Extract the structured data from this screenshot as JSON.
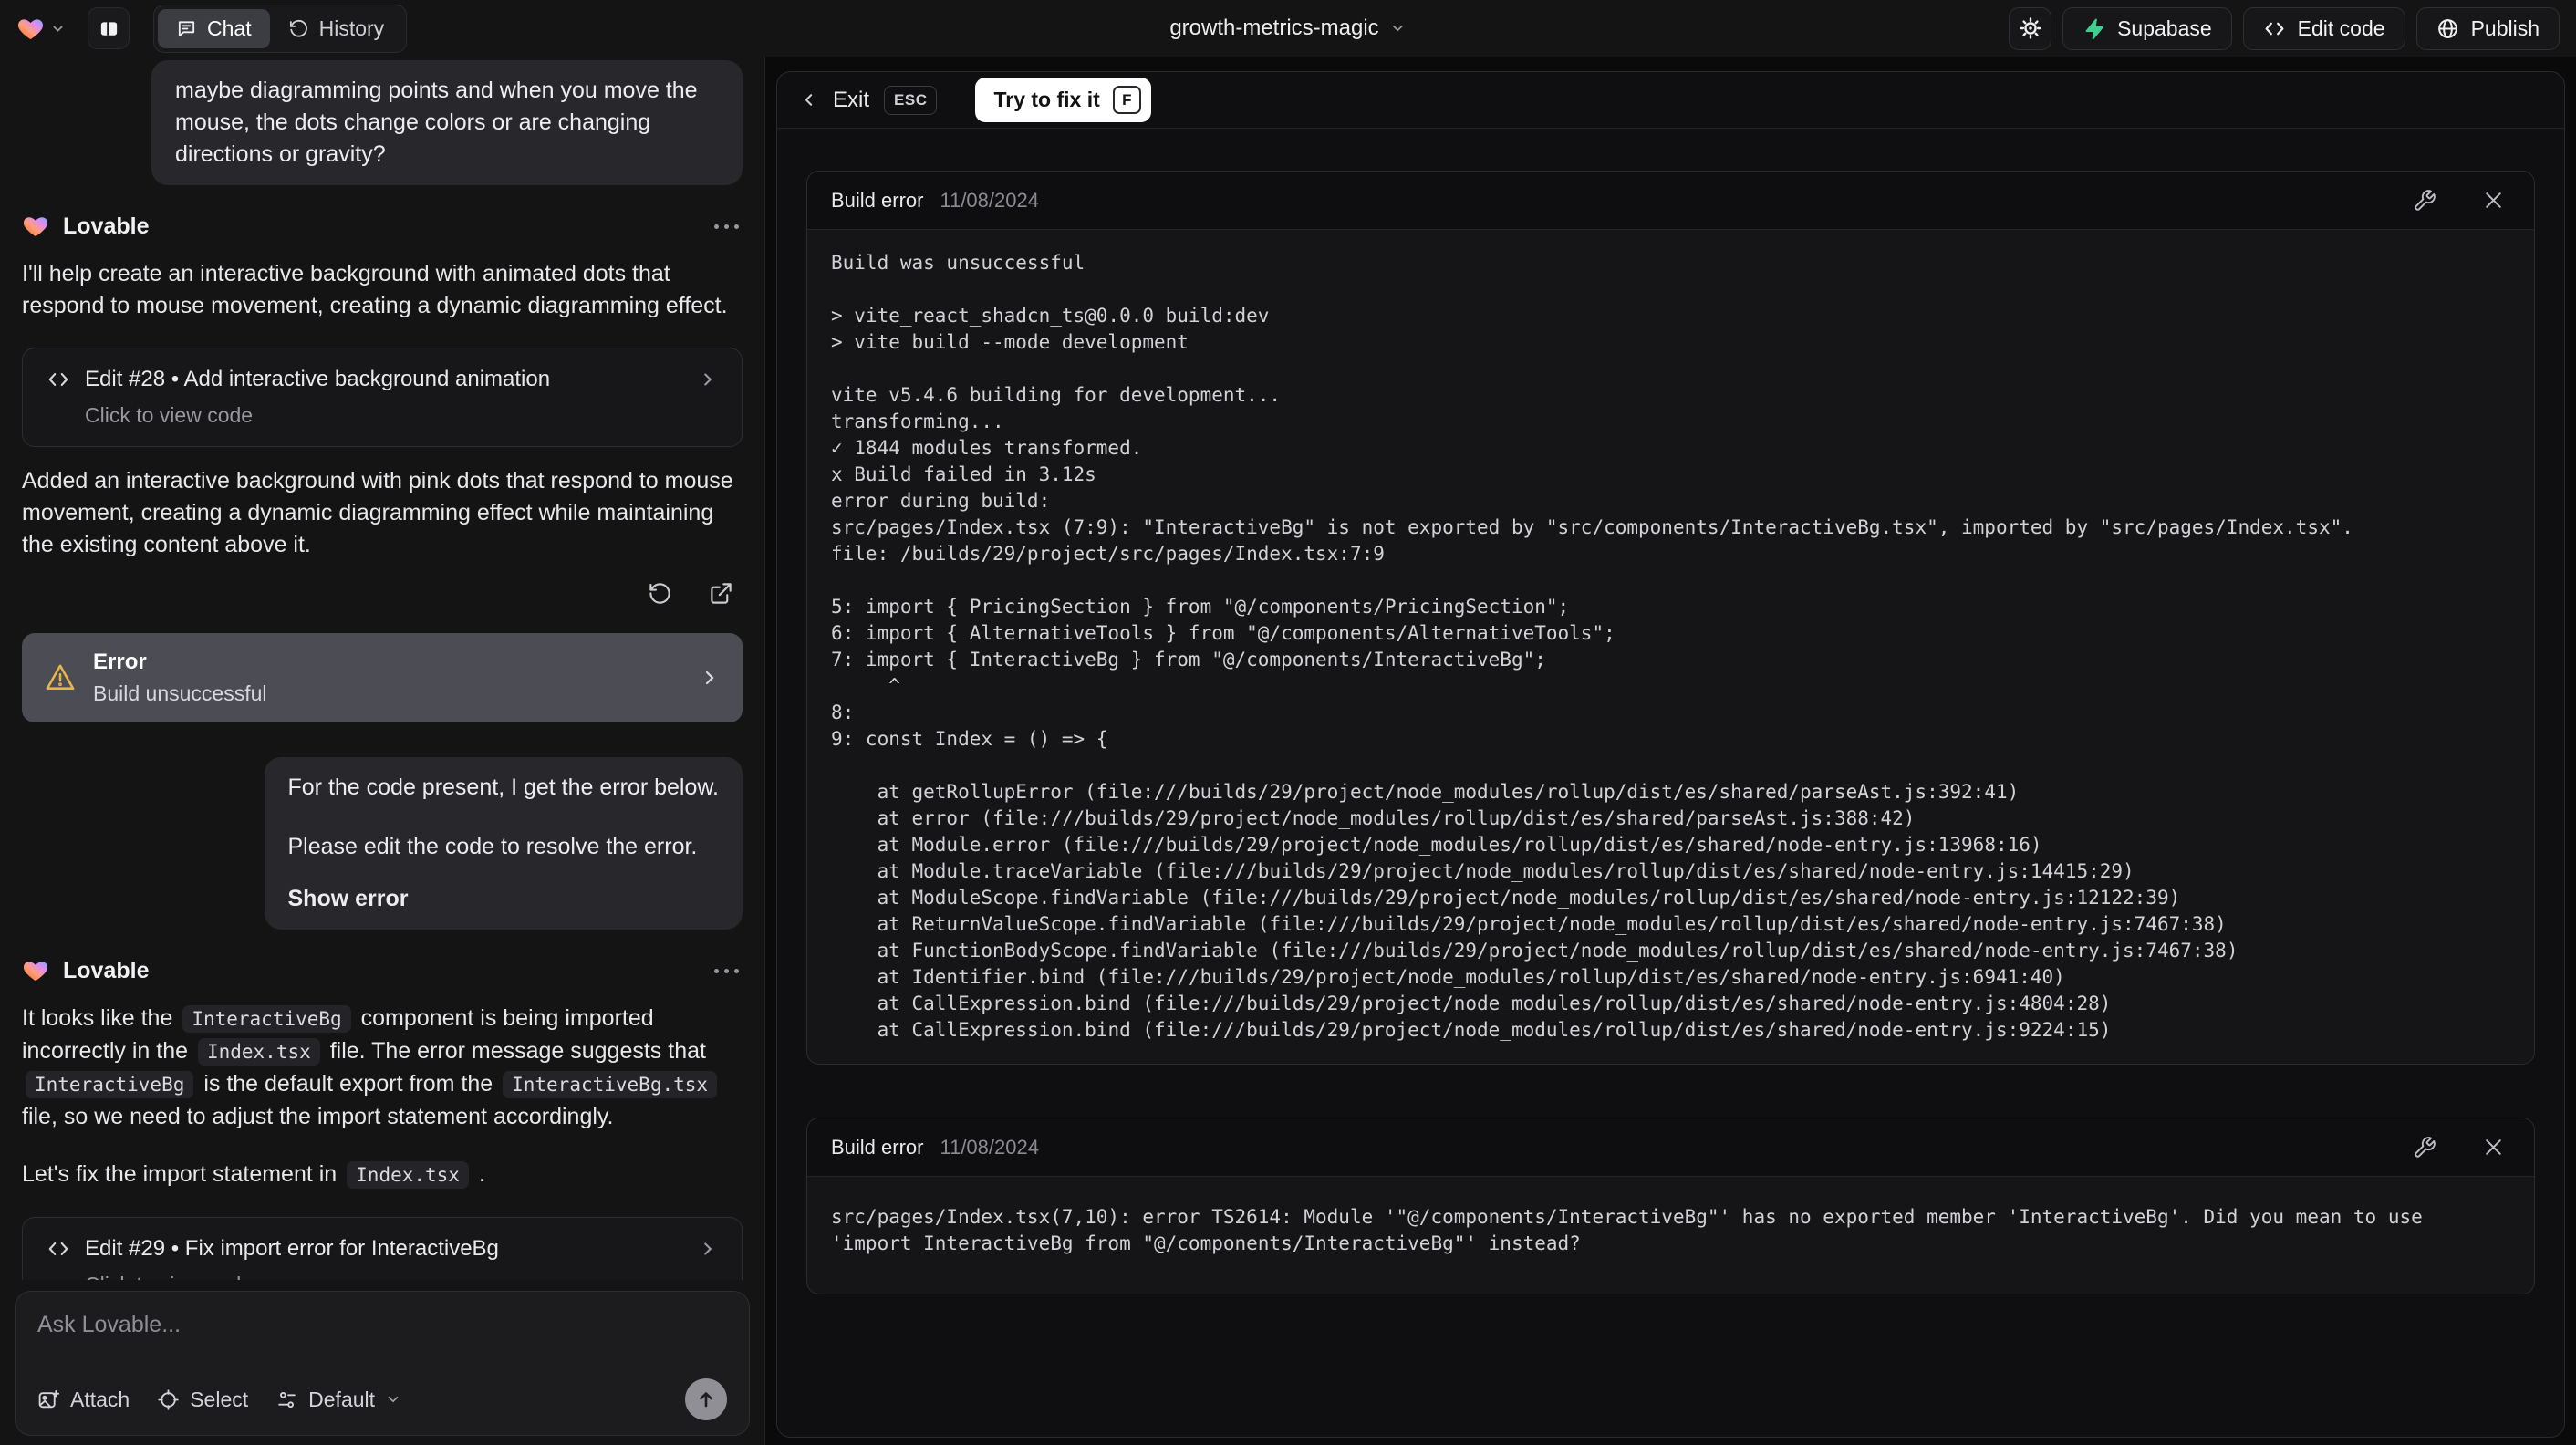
{
  "topbar": {
    "project_name": "growth-metrics-magic",
    "tabs": {
      "chat": "Chat",
      "history": "History"
    },
    "actions": {
      "supabase": "Supabase",
      "edit_code": "Edit code",
      "publish": "Publish"
    }
  },
  "chat": {
    "assistant": {
      "name": "Lovable"
    },
    "user_message_1": "maybe diagramming points and when you move the mouse, the dots change colors or are changing directions or gravity?",
    "intro": "I'll help create an interactive background with animated dots that respond to mouse movement, creating a dynamic diagramming effect.",
    "edit_card_28": {
      "title": "Edit #28 • Add interactive background animation",
      "subtitle": "Click to view code"
    },
    "summary": "Added an interactive background with pink dots that respond to mouse movement, creating a dynamic diagramming effect while maintaining the existing content above it.",
    "error_card": {
      "title": "Error",
      "subtitle": "Build unsuccessful"
    },
    "user_message_2": {
      "p1": "For the code present, I get the error below.",
      "p2": "Please edit the code to resolve the error.",
      "p3": "Show error"
    },
    "fix_message_segments": [
      {
        "text": "It looks like the "
      },
      {
        "text": "InteractiveBg",
        "code": true
      },
      {
        "text": " component is being imported incorrectly in the "
      },
      {
        "text": "Index.tsx",
        "code": true
      },
      {
        "text": " file. The error message suggests that "
      },
      {
        "text": "InteractiveBg",
        "code": true
      },
      {
        "text": " is the default export from the "
      },
      {
        "text": "InteractiveBg.tsx",
        "code": true
      },
      {
        "text": " file, so we need to adjust the import statement accordingly."
      }
    ],
    "fix_line_segments": [
      {
        "text": "Let's fix the import statement in "
      },
      {
        "text": "Index.tsx",
        "code": true
      },
      {
        "text": " ."
      }
    ],
    "edit_card_29": {
      "title": "Edit #29 • Fix import error for InteractiveBg",
      "subtitle": "Click to view code"
    },
    "composer": {
      "placeholder": "Ask Lovable...",
      "attach": "Attach",
      "select": "Select",
      "model": "Default"
    }
  },
  "overlay": {
    "exit_label": "Exit",
    "esc_key": "ESC",
    "fix_button": "Try to fix it",
    "fix_key": "F",
    "cards": [
      {
        "title": "Build error",
        "date": "11/08/2024",
        "log": [
          "Build was unsuccessful",
          "",
          "> vite_react_shadcn_ts@0.0.0 build:dev",
          "> vite build --mode development",
          "",
          "vite v5.4.6 building for development...",
          "transforming...",
          "✓ 1844 modules transformed.",
          "x Build failed in 3.12s",
          "error during build:",
          "src/pages/Index.tsx (7:9): \"InteractiveBg\" is not exported by \"src/components/InteractiveBg.tsx\", imported by \"src/pages/Index.tsx\".",
          "file: /builds/29/project/src/pages/Index.tsx:7:9",
          "",
          "5: import { PricingSection } from \"@/components/PricingSection\";",
          "6: import { AlternativeTools } from \"@/components/AlternativeTools\";",
          "7: import { InteractiveBg } from \"@/components/InteractiveBg\";",
          "     ^",
          "8:",
          "9: const Index = () => {",
          "",
          "    at getRollupError (file:///builds/29/project/node_modules/rollup/dist/es/shared/parseAst.js:392:41)",
          "    at error (file:///builds/29/project/node_modules/rollup/dist/es/shared/parseAst.js:388:42)",
          "    at Module.error (file:///builds/29/project/node_modules/rollup/dist/es/shared/node-entry.js:13968:16)",
          "    at Module.traceVariable (file:///builds/29/project/node_modules/rollup/dist/es/shared/node-entry.js:14415:29)",
          "    at ModuleScope.findVariable (file:///builds/29/project/node_modules/rollup/dist/es/shared/node-entry.js:12122:39)",
          "    at ReturnValueScope.findVariable (file:///builds/29/project/node_modules/rollup/dist/es/shared/node-entry.js:7467:38)",
          "    at FunctionBodyScope.findVariable (file:///builds/29/project/node_modules/rollup/dist/es/shared/node-entry.js:7467:38)",
          "    at Identifier.bind (file:///builds/29/project/node_modules/rollup/dist/es/shared/node-entry.js:6941:40)",
          "    at CallExpression.bind (file:///builds/29/project/node_modules/rollup/dist/es/shared/node-entry.js:4804:28)",
          "    at CallExpression.bind (file:///builds/29/project/node_modules/rollup/dist/es/shared/node-entry.js:9224:15)"
        ]
      },
      {
        "title": "Build error",
        "date": "11/08/2024",
        "log": [
          "src/pages/Index.tsx(7,10): error TS2614: Module '\"@/components/InteractiveBg\"' has no exported member 'InteractiveBg'. Did you mean to use 'import InteractiveBg from \"@/components/InteractiveBg\"' instead?"
        ]
      }
    ]
  },
  "colors": {
    "supabase_green": "#3ecf8e",
    "warning_amber": "#e7b549",
    "error_card_bg": "#4c4c54",
    "accent_send": "#8f8f95"
  }
}
